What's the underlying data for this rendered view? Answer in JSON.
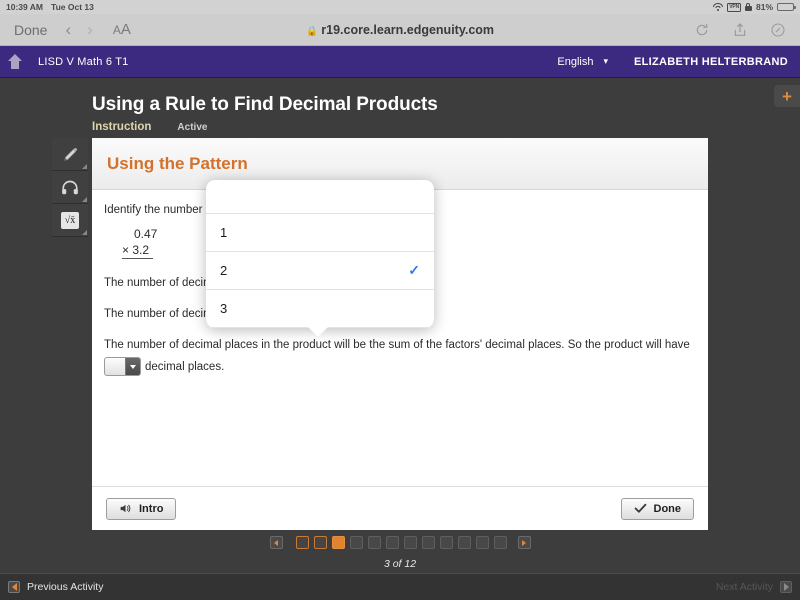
{
  "ios_status": {
    "time": "10:39 AM",
    "date": "Tue Oct 13",
    "wifi_icon": "wifi-icon",
    "vpn_label": "VPN",
    "lock_icon": "rotation-lock-icon",
    "battery_percent": "81%",
    "battery_icon": "battery-icon"
  },
  "safari": {
    "done_label": "Done",
    "back_icon": "chevron-left-icon",
    "forward_icon": "chevron-right-icon",
    "text_size_label": "AA",
    "lock_glyph": "A",
    "url": "r19.core.learn.edgenuity.com",
    "reload_icon": "reload-icon",
    "share_icon": "share-icon",
    "compass_icon": "compass-icon"
  },
  "app_header": {
    "home_icon": "home-icon",
    "course_name": "LISD V Math 6 T1",
    "language": "English",
    "language_caret": "▾",
    "user_name": "ELIZABETH HELTERBRAND"
  },
  "lesson": {
    "title": "Using a Rule to Find Decimal Products",
    "tab_instruction": "Instruction",
    "tab_active": "Active",
    "add_button": "+"
  },
  "tools": [
    {
      "name": "pencil-tool",
      "icon": "pencil-icon"
    },
    {
      "name": "audio-tool",
      "icon": "headphones-icon"
    },
    {
      "name": "math-tool",
      "icon": "square-root-icon"
    }
  ],
  "card": {
    "heading": "Using the Pattern",
    "line1": "Identify the number of decimal places in each factor.",
    "problem_line1": "0.47",
    "problem_line2": "× 3.2",
    "line2_prefix": "The number of decimal places in 0.47 is",
    "line2_suffix": ".",
    "line3_prefix": "The number of decimal places in 3.2 is",
    "line3_suffix": ".",
    "paragraph": "The number of decimal places in the product will be the sum of the factors' decimal places. So the product will have",
    "paragraph_suffix": "decimal places.",
    "select_decimal_047": {
      "value": "",
      "placeholder": ""
    },
    "select_decimal_32": {
      "value": "2"
    },
    "select_product": {
      "value": ""
    }
  },
  "dropdown": {
    "options": [
      "",
      "1",
      "2",
      "3"
    ],
    "selected": "2",
    "check_glyph": "✓"
  },
  "card_footer": {
    "intro_label": "Intro",
    "intro_icon": "speaker-icon",
    "done_label": "Done",
    "done_icon": "check-icon"
  },
  "pagination": {
    "prev_icon": "triangle-left-icon",
    "next_icon": "triangle-right-icon",
    "total": 12,
    "current": 3,
    "visited": 2,
    "progress_label": "3 of 12"
  },
  "bottom_nav": {
    "previous_label": "Previous Activity",
    "previous_icon": "triangle-left-icon",
    "next_label": "Next Activity",
    "next_icon": "triangle-right-icon"
  },
  "colors": {
    "purple_header": "#3b2a80",
    "orange_accent": "#d2722c",
    "dark_bg": "#3d3d3d",
    "check_blue": "#2d7bf0"
  }
}
